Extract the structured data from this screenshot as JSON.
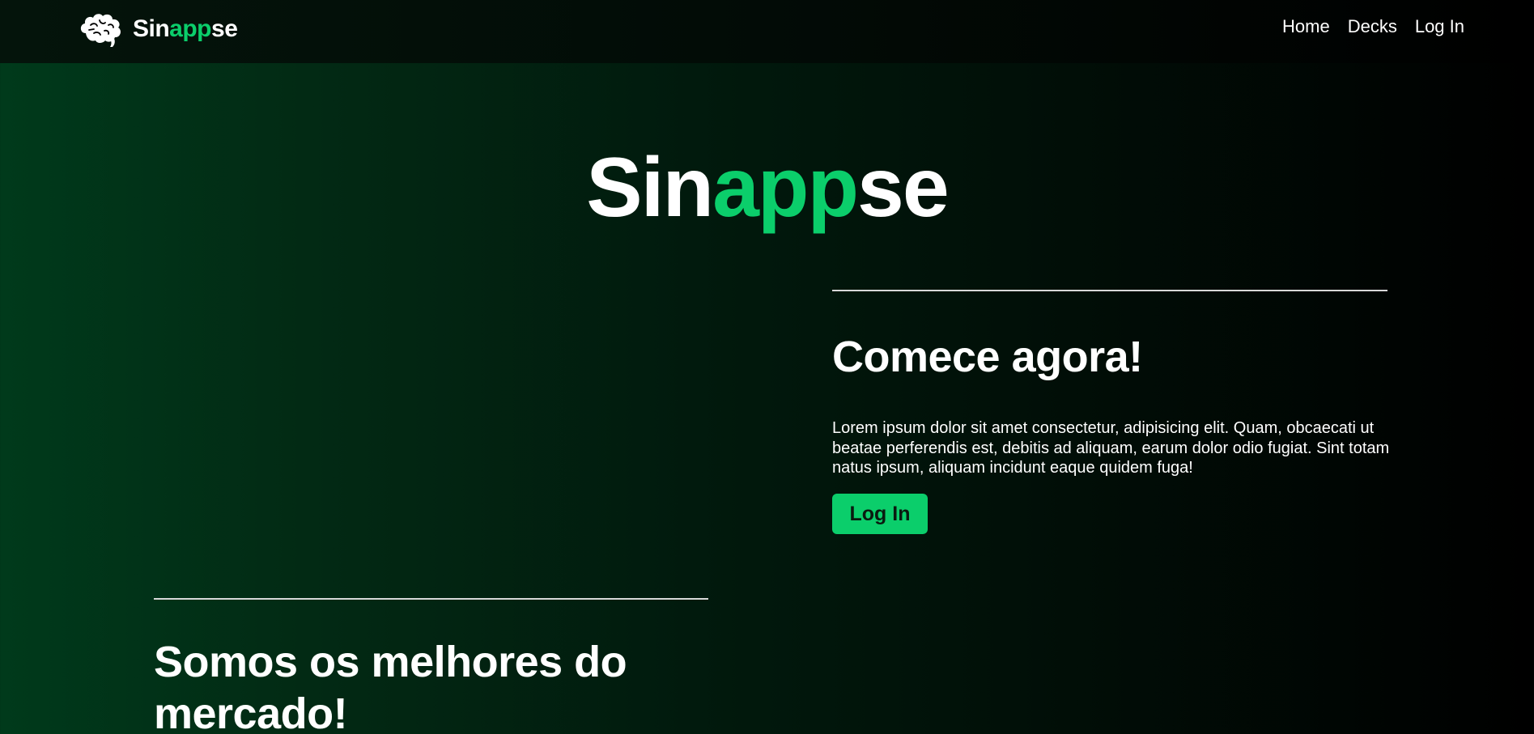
{
  "navbar": {
    "logo_icon": "brain-icon",
    "brand": {
      "part1": "Sin",
      "part2": "app",
      "part3": "se"
    },
    "links": [
      "Home",
      "Decks",
      "Log In"
    ]
  },
  "hero": {
    "title": {
      "part1": "Sin",
      "part2": "app",
      "part3": "se"
    }
  },
  "cta_section": {
    "title": "Comece agora!",
    "text": "Lorem ipsum dolor sit amet consectetur, adipisicing elit. Quam, obcaecati ut beatae perferendis est, debitis ad aliquam, earum dolor odio fugiat. Sint totam natus ipsum, aliquam incidunt eaque quidem fuga!",
    "button_label": "Log In"
  },
  "about_section": {
    "title": "Somos os melhores do mercado!"
  },
  "colors": {
    "accent": "#0bce6b",
    "background_start": "#003a1b",
    "background_end": "#000000"
  }
}
